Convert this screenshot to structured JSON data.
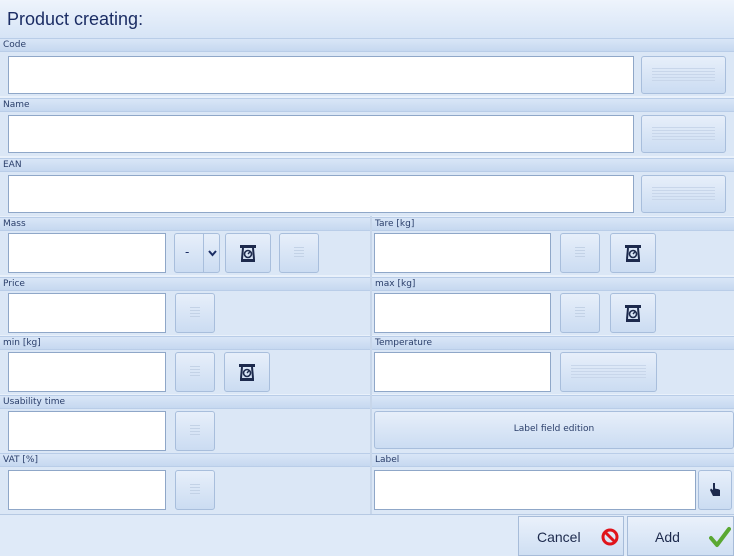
{
  "title": "Product creating:",
  "fields": {
    "code": "Code",
    "name": "Name",
    "ean": "EAN",
    "mass": "Mass",
    "tare": "Tare [kg]",
    "price": "Price",
    "max": "max [kg]",
    "min": "min [kg]",
    "temperature": "Temperature",
    "usability": "Usability time",
    "vat": "VAT [%]",
    "label": "Label"
  },
  "mass_select": {
    "value": "-"
  },
  "label_field_edition": "Label field edition",
  "buttons": {
    "cancel": "Cancel",
    "add": "Add"
  },
  "colors": {
    "cancel_icon": "#e0141b",
    "add_icon": "#5aa832",
    "title_text": "#1b2d64"
  }
}
